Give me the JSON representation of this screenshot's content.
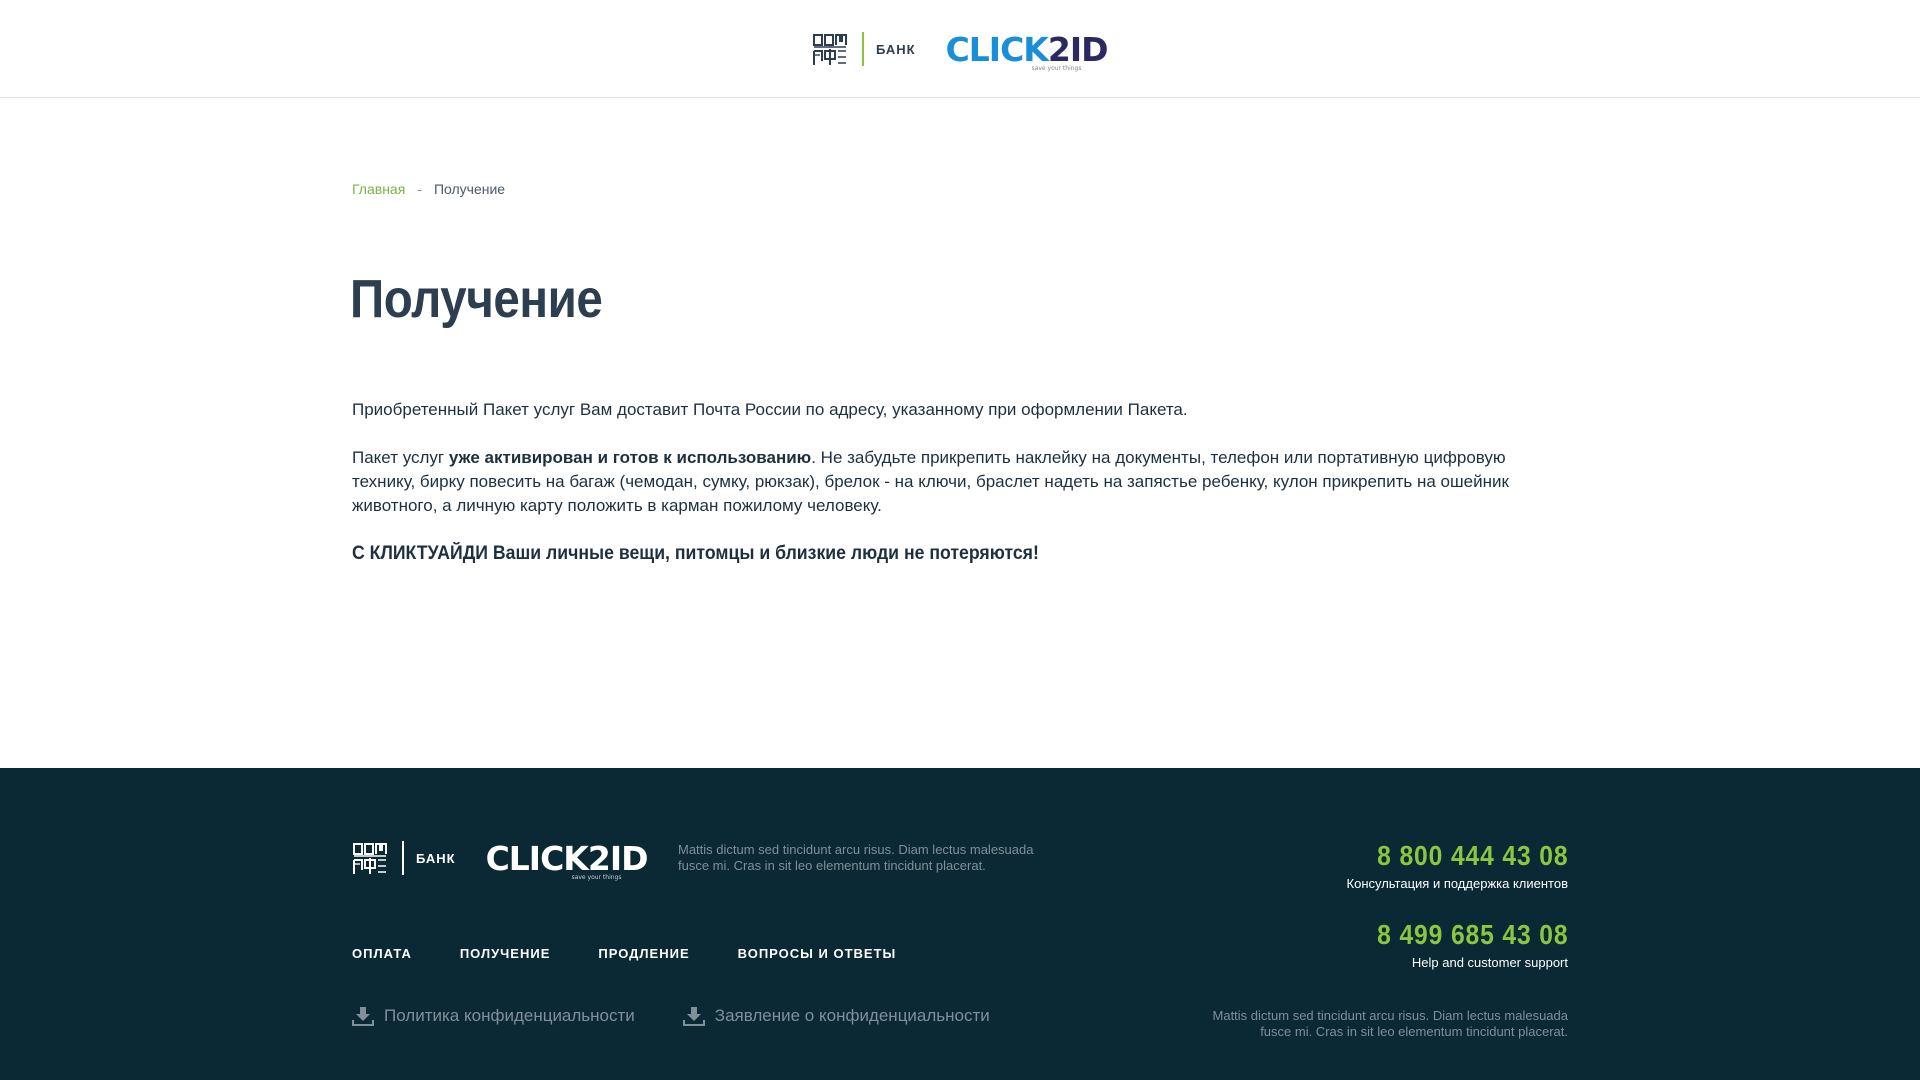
{
  "header": {
    "bank_label": "БАНК",
    "clickid_part1": "CLICK",
    "clickid_part2": "2ID",
    "clickid_tagline": "save your things",
    "domrf_logo": "domrf-logo-icon"
  },
  "breadcrumb": {
    "home": "Главная",
    "separator": "-",
    "current": "Получение"
  },
  "page": {
    "title": "Получение",
    "paragraph1": "Приобретенный Пакет услуг Вам доставит Почта России по адресу, указанному при оформлении Пакета.",
    "paragraph2_prefix": "Пакет услуг ",
    "paragraph2_bold": "уже активирован и готов к использованию",
    "paragraph2_suffix": ". Не забудьте прикрепить наклейку на документы, телефон  или портативную цифровую технику, бирку повесить на багаж (чемодан, сумку, рюкзак), брелок - на ключи, браслет надеть на запястье ребенку, кулон прикрепить на ошейник животного, а личную карту положить в карман пожилому человеку.",
    "slogan": "С КЛИКТУАЙДИ Ваши личные вещи, питомцы и близкие люди не потеряются!"
  },
  "footer": {
    "bank_label": "БАНК",
    "clickid_text": "CLICK2ID",
    "clickid_tagline": "save your things",
    "description": "Mattis dictum sed tincidunt arcu risus. Diam lectus malesuada fusce mi. Cras in sit leo elementum tincidunt placerat.",
    "nav": [
      "ОПЛАТА",
      "ПОЛУЧЕНИЕ",
      "ПРОДЛЕНИЕ",
      "ВОПРОСЫ И ОТВЕТЫ"
    ],
    "docs": [
      "Политика конфиденциальности",
      "Заявление о конфиденциальности"
    ],
    "phones": [
      {
        "number": "8 800 444 43 08",
        "caption": "Консультация и поддержка клиентов"
      },
      {
        "number": "8 499 685 43 08",
        "caption": "Help and customer support"
      }
    ],
    "description_right": "Mattis dictum sed tincidunt arcu risus. Diam lectus malesuada fusce mi. Cras in sit leo elementum tincidunt placerat."
  },
  "colors": {
    "accent_green": "#8cc63f",
    "link_green": "#7cb342",
    "footer_bg": "#0b2835",
    "heading": "#2c3e50",
    "clickid_blue": "#1a8fd8",
    "clickid_navy": "#2a2960"
  }
}
